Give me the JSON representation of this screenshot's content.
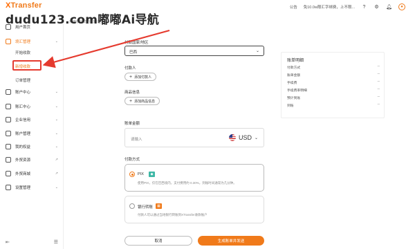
{
  "header": {
    "logo_x": "X",
    "logo_rest": "Transfer",
    "announcement_label": "公告",
    "notice_text": "免10.0w限汇字绑费，上不限...",
    "icons": [
      "help-icon",
      "gear-icon",
      "bell-icon",
      "user-icon"
    ]
  },
  "watermark": "dudu123.com嘟嘟Ai导航",
  "page": {
    "subtitle": "用审核提交的国家/地区"
  },
  "sidebar": {
    "items": [
      {
        "label": "用户首页",
        "icon": "home-icon",
        "arrow": ""
      },
      {
        "label": "境汇管理",
        "icon": "wallet-icon",
        "arrow": "⌄",
        "active": true
      },
      {
        "label": "账户中心",
        "icon": "account-icon",
        "arrow": "⌄"
      },
      {
        "label": "账汇中心",
        "icon": "ledger-icon",
        "arrow": "⌄"
      },
      {
        "label": "企业信用",
        "icon": "shield-icon",
        "arrow": "⌄"
      },
      {
        "label": "账户管理",
        "icon": "folder-icon",
        "arrow": "⌄"
      },
      {
        "label": "我的权益",
        "icon": "gift-icon",
        "arrow": "⌄"
      },
      {
        "label": "外贸资源",
        "icon": "globe-icon",
        "arrow": "↗"
      },
      {
        "label": "外贸商城",
        "icon": "shop-icon",
        "arrow": "↗"
      },
      {
        "label": "设置管理",
        "icon": "settings-icon",
        "arrow": "⌄"
      }
    ],
    "sub_items": [
      {
        "label": "开始收款"
      },
      {
        "label": "新增收款",
        "selected": true
      },
      {
        "label": "订单管理"
      }
    ],
    "bottom_left_icon": "exit-icon",
    "bottom_right_icon": "collapse-icon"
  },
  "form": {
    "country_label": "付款国家/地区",
    "country_value": "巴西",
    "payer_label": "付款人",
    "add_payer": "添加付款人",
    "attachment_label": "商品信息",
    "add_attachment": "添加商品信息",
    "amount_label": "账单金额",
    "amount_placeholder": "请输入",
    "currency": "USD",
    "method_label": "付款方式",
    "methods": [
      {
        "name": "PIX",
        "badge": "◆",
        "desc": "使用PIX，仅在巴西境内，支付费用约 0.30%，到账时间通常为几分钟。",
        "selected": true
      },
      {
        "name": "银行转账",
        "badge": "▦",
        "desc": "付款人可以通过当地银行转账到XTransfer收款账户",
        "selected": false
      }
    ],
    "cancel": "取消",
    "submit": "生成账单并发送"
  },
  "summary": {
    "title": "账单明细",
    "rows": [
      {
        "label": "付款方式",
        "value": "--"
      },
      {
        "label": "账单金额",
        "value": "--"
      },
      {
        "label": "手续费",
        "value": "--"
      },
      {
        "label": "手续费率明细",
        "value": "--"
      },
      {
        "label": "预计到账",
        "value": "--"
      },
      {
        "label": "到账",
        "value": "--"
      }
    ]
  },
  "colors": {
    "accent": "#f07a1a",
    "highlight": "#e53a2e",
    "pix_badge": "#3fb8a6",
    "bank_badge": "#f07a1a"
  }
}
